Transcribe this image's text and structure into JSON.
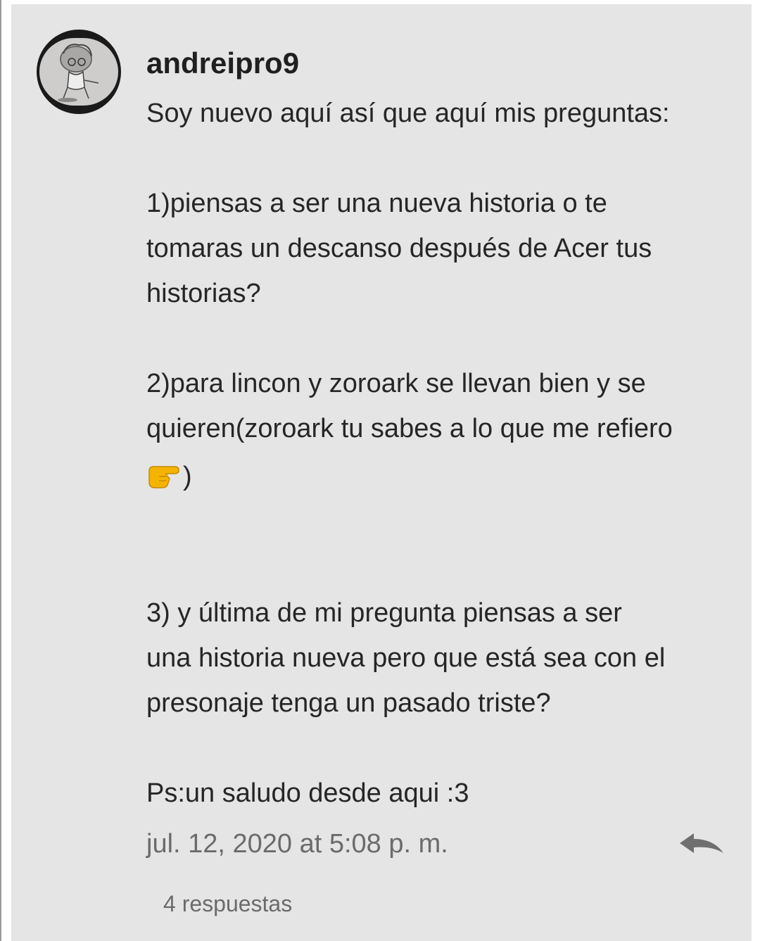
{
  "comment": {
    "author": "andreipro9",
    "lines": [
      "Soy nuevo aquí así que aquí mis preguntas:",
      "1)piensas a ser una nueva historia o te",
      "tomaras un descanso después de Acer tus",
      "historias?",
      "2)para lincon y zoroark se llevan bien y se",
      "quieren(zoroark tu sabes a lo que me refiero",
      ")",
      "3) y última de mi pregunta piensas a ser",
      "una historia nueva pero que está sea con el",
      "presonaje tenga un pasado triste?",
      "Ps:un saludo desde aqui :3"
    ],
    "emoji_icon": "pointing-right-hand-icon",
    "timestamp": "jul. 12, 2020 at 5:08 p. m.",
    "replies_label": "4 respuestas",
    "reply_icon": "reply-arrow-icon"
  },
  "colors": {
    "card_background": "#e5e5e5",
    "text": "#262626",
    "muted_text": "#6b6b6b",
    "reply_icon": "#6f6f6f",
    "emoji": "#f5b400"
  }
}
